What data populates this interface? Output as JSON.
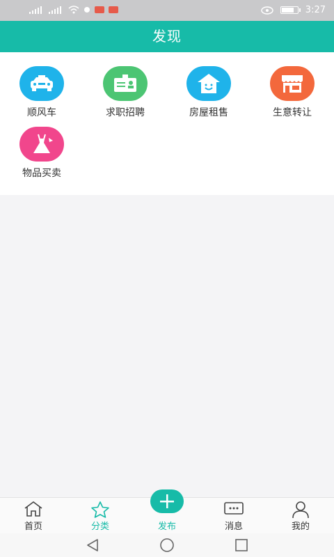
{
  "status_bar": {
    "time": "3:27"
  },
  "header": {
    "title": "发现"
  },
  "categories": [
    {
      "label": "顺风车",
      "icon": "car-icon",
      "color": "#1fb3ea"
    },
    {
      "label": "求职招聘",
      "icon": "id-card-icon",
      "color": "#4cc573"
    },
    {
      "label": "房屋租售",
      "icon": "house-icon",
      "color": "#1fb3ea"
    },
    {
      "label": "生意转让",
      "icon": "shop-icon",
      "color": "#f3683c"
    },
    {
      "label": "物品买卖",
      "icon": "dress-icon",
      "color": "#f1468c"
    }
  ],
  "tabbar": {
    "items": [
      {
        "label": "首页",
        "icon": "home-icon"
      },
      {
        "label": "分类",
        "icon": "star-icon",
        "active": true
      },
      {
        "label": "发布",
        "icon": "plus-icon"
      },
      {
        "label": "消息",
        "icon": "message-icon"
      },
      {
        "label": "我的",
        "icon": "user-icon"
      }
    ]
  },
  "colors": {
    "accent": "#17bba8"
  }
}
